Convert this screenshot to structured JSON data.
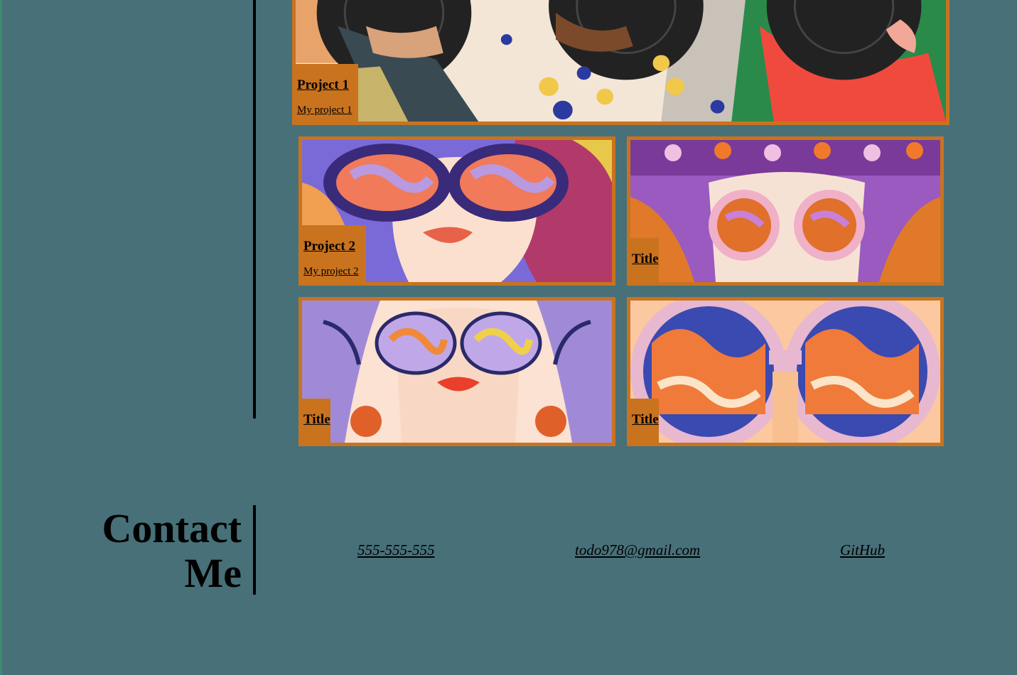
{
  "projects": [
    {
      "title": "Project 1",
      "subtitle": "My project 1"
    },
    {
      "title": "Project 2",
      "subtitle": "My project 2"
    },
    {
      "title": "Title"
    },
    {
      "title": "Title"
    },
    {
      "title": "Title"
    }
  ],
  "contact": {
    "heading_line1": "Contact",
    "heading_line2": "Me",
    "phone": "555-555-555",
    "email": "todo978@gmail.com",
    "github": "GitHub"
  },
  "colors": {
    "background": "#477079",
    "accent": "#c9731f",
    "text": "#000000"
  }
}
